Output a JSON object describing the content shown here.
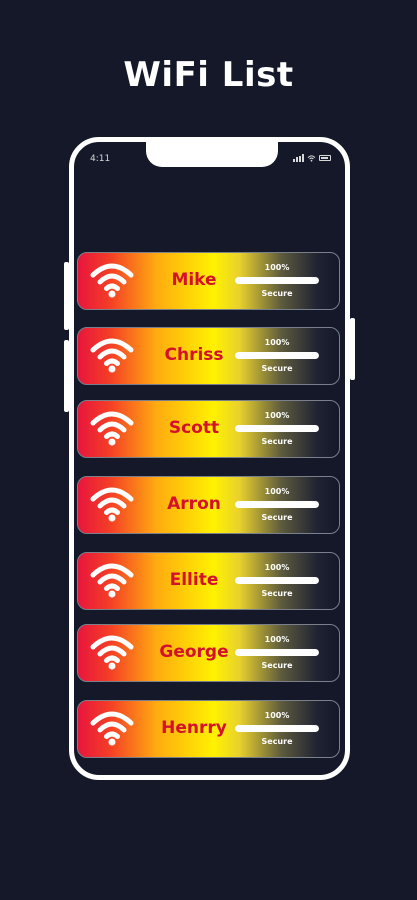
{
  "status_bar": {
    "time": "4:11"
  },
  "title": "WiFi List",
  "networks": [
    {
      "name": "Mike",
      "strength_label": "100%",
      "strength": 1.0,
      "security": "Secure"
    },
    {
      "name": "Chriss",
      "strength_label": "100%",
      "strength": 1.0,
      "security": "Secure"
    },
    {
      "name": "Scott",
      "strength_label": "100%",
      "strength": 1.0,
      "security": "Secure"
    },
    {
      "name": "Arron",
      "strength_label": "100%",
      "strength": 1.0,
      "security": "Secure"
    },
    {
      "name": "Ellite",
      "strength_label": "100%",
      "strength": 1.0,
      "security": "Secure"
    },
    {
      "name": "George",
      "strength_label": "100%",
      "strength": 1.0,
      "security": "Secure"
    },
    {
      "name": "Henrry",
      "strength_label": "100%",
      "strength": 1.0,
      "security": "Secure"
    }
  ],
  "colors": {
    "background": "#141828",
    "name_text": "#d4102b",
    "frame": "#ffffff"
  },
  "icons": {
    "network": "wifi-icon"
  }
}
